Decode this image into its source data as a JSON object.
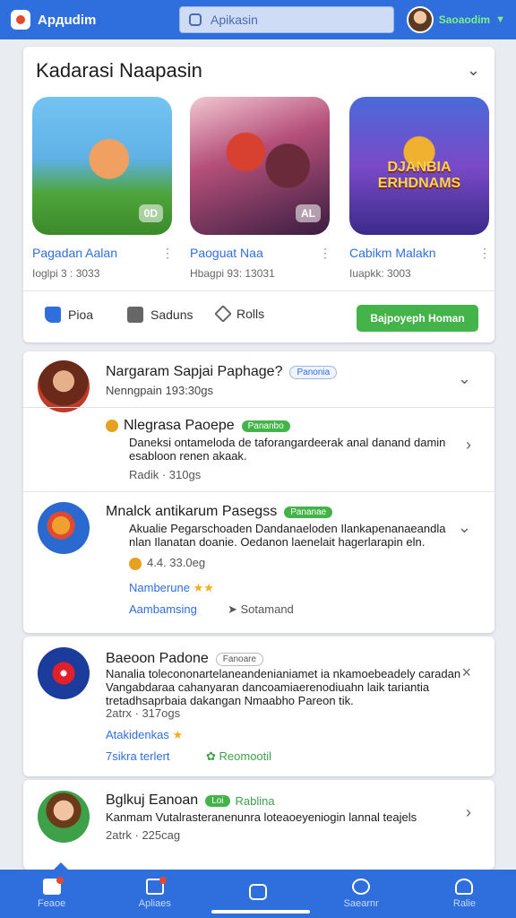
{
  "header": {
    "app_name": "Apдudim",
    "search_placeholder": "Apikasin",
    "username": "Saoaodim"
  },
  "featured": {
    "title": "Kadarasi Naapasin",
    "games": [
      {
        "name": "Pagadan Aalan",
        "meta": "Ioglpi 3 : 3033",
        "badge": "0D"
      },
      {
        "name": "Paoguat Naa",
        "meta": "Hbagpi 93: 13031",
        "badge": "AL"
      },
      {
        "name": "Cabikm Malakn",
        "meta": "Iuapkk: 3003",
        "logo": "DJANBIA ERHDNAMS"
      }
    ],
    "actions": {
      "like": "Pioa",
      "comment": "Saduns",
      "share": "Rolls",
      "primary": "Bajpoyeph Homan"
    }
  },
  "posts": [
    {
      "title": "Nargaram Sapjai Paphage?",
      "pill": "Panonia",
      "sub": "Nenngpain 193:30gs"
    },
    {
      "title": "Nlegrasa Paoepe",
      "pill": "Pananbo",
      "body": "Daneksi ontameloda de taforangardeerak anal danand damin esabloon renen akaak.",
      "meta": "Radik · 310gs"
    },
    {
      "title": "Mnalck antikarum Pasegss",
      "pill": "Pananae",
      "body": "Akualie Pegarschoaden Dandanaeloden Ilankapenanaeandla nlan Ilanatan doanie. Oedanon laenelait hagerlarapin eln.",
      "meta": "4.4. 33.0eg",
      "link": "Namberune",
      "link2": "Aambamsing",
      "link3": "Sotamand"
    },
    {
      "title": "Baeoon Padone",
      "pill": "Fanoare",
      "body": "Nanalia tolecononartelaneandenianiamet ia nkamoebeadely caradan Vangabdaraa cahanyaran dancoamiaerenodiuahn laik tariantia tretadhsaprbaia dakangan Nmaabho Pareon tik.",
      "meta": "2atrx · 317ogs",
      "link": "Atakidenkas",
      "link2": "7sikra terlert",
      "link3": "Reomootil"
    },
    {
      "title": "Bglkuj Eanoan",
      "pill": "Loi",
      "pill2": "Rablina",
      "body": "Kanmam Vutalrasteranenunra loteaoeyeniogin lannal teajels",
      "meta": "2atrk · 225cag"
    }
  ],
  "nav": {
    "home": "Feaoe",
    "apps": "Apliaes",
    "center": "",
    "search": "Saearnr",
    "profile": "Ralie"
  }
}
